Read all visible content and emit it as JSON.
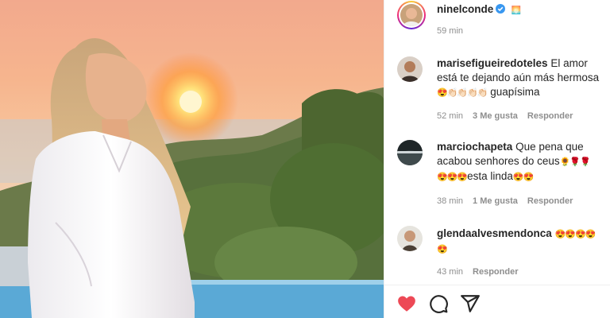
{
  "post": {
    "author": "ninelconde",
    "author_badge_emoji": "🌅",
    "time": "59 min"
  },
  "comments": [
    {
      "user": "marisefigueiredoteles",
      "text_line1": "El amor",
      "text_line2": "está te dejando aún más hermosa",
      "text_line3_emoji": "😍👏🏻👏🏻👏🏻👏🏻",
      "text_line3": " guapísima",
      "time": "52 min",
      "likes": "3 Me gusta",
      "reply": "Responder"
    },
    {
      "user": "marciochapeta",
      "text_line1": "Que pena que",
      "text_line2": "acabou senhores do ceus",
      "text_line2_emoji": "🌻🌹🌹",
      "text_line3_emoji_a": "😍😍😍",
      "text_line3": "esta linda",
      "text_line3_emoji_b": "😍😍",
      "time": "38 min",
      "likes": "1 Me gusta",
      "reply": "Responder"
    },
    {
      "user": "glendaalvesmendonca",
      "text_line1_emoji": "😍😍😍😍",
      "text_line2_emoji": "😍",
      "time": "43 min",
      "reply": "Responder"
    }
  ],
  "icons": [
    "heart-icon",
    "comment-icon",
    "share-icon",
    "verified-icon"
  ],
  "colors": {
    "like_red": "#ed4956",
    "verified_blue": "#3897f0",
    "muted": "#8e8e8e"
  }
}
